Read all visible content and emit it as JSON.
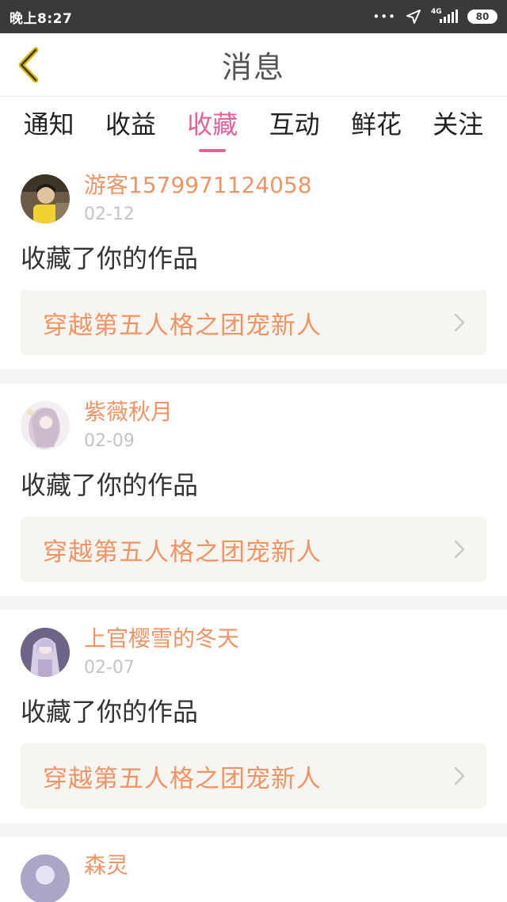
{
  "status_bar": {
    "time": "晚上8:27",
    "network": "4G",
    "battery": "80"
  },
  "header": {
    "title": "消息",
    "back_icon": "chevron-left-icon"
  },
  "tabs": [
    {
      "label": "通知",
      "active": false
    },
    {
      "label": "收益",
      "active": false
    },
    {
      "label": "收藏",
      "active": true
    },
    {
      "label": "互动",
      "active": false
    },
    {
      "label": "鲜花",
      "active": false
    },
    {
      "label": "关注",
      "active": false
    }
  ],
  "colors": {
    "accent": "#e5619a",
    "username": "#f09466",
    "work_bg": "#f6f5ef"
  },
  "messages": [
    {
      "username": "游客1579971124058",
      "date": "02-12",
      "action": "收藏了你的作品",
      "work_title": "穿越第五人格之团宠新人"
    },
    {
      "username": "紫薇秋月",
      "date": "02-09",
      "action": "收藏了你的作品",
      "work_title": "穿越第五人格之团宠新人"
    },
    {
      "username": "上官樱雪的冬天",
      "date": "02-07",
      "action": "收藏了你的作品",
      "work_title": "穿越第五人格之团宠新人"
    },
    {
      "username": "森灵",
      "date": "",
      "action": "",
      "work_title": ""
    }
  ]
}
